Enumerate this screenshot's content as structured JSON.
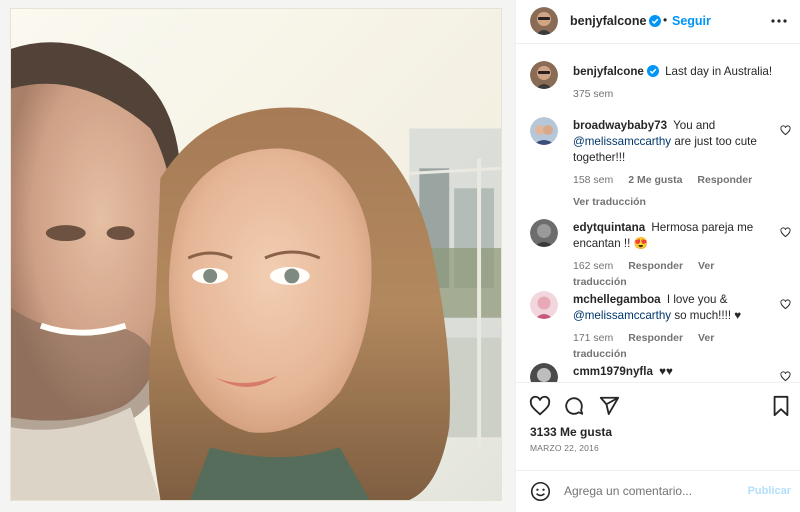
{
  "post": {
    "author": "benjyfalcone",
    "follow_label": "Seguir",
    "dot": "•",
    "caption": "Last day in Australia!",
    "caption_time": "375 sem",
    "likes": "3133 Me gusta",
    "date": "MARZO 22, 2016"
  },
  "comments": [
    {
      "user": "broadwaybaby73",
      "text_before": "You and",
      "mention": "@melissamccarthy",
      "text_after": "are just too cute together!!!",
      "time": "158 sem",
      "likes": "2 Me gusta",
      "reply": "Responder",
      "translate": "Ver traducción"
    },
    {
      "user": "edytquintana",
      "text_before": "Hermosa pareja me encantan !!",
      "mention": "",
      "text_after": "😍",
      "time": "162 sem",
      "likes": "",
      "reply": "Responder",
      "translate": "Ver traducción"
    },
    {
      "user": "mchellegamboa",
      "text_before": "I love you &",
      "mention": "@melissamccarthy",
      "text_after": "so much!!!! ♥",
      "time": "171 sem",
      "likes": "",
      "reply": "Responder",
      "translate": "Ver traducción"
    },
    {
      "user": "cmm1979nyfla",
      "text_before": "♥♥",
      "mention": "",
      "text_after": "",
      "time": "",
      "likes": "",
      "reply": "",
      "translate": ""
    }
  ],
  "composer": {
    "placeholder": "Agrega un comentario...",
    "publish_label": "Publicar"
  },
  "icons": {
    "verified": "verified-badge-icon",
    "more": "more-options-icon",
    "like": "heart-icon",
    "comment": "comment-icon",
    "share": "share-icon",
    "save": "bookmark-icon",
    "emoji": "emoji-icon"
  },
  "colors": {
    "accent": "#0095f6",
    "verified": "#0095f6",
    "muted": "#737373",
    "publish_disabled": "#b2dffc"
  }
}
